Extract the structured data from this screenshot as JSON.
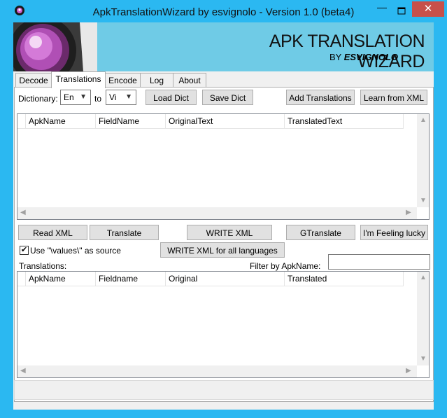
{
  "window": {
    "title": "ApkTranslationWizard by esvignolo - Version 1.0 (beta4)",
    "close_glyph": "✕",
    "minimize_glyph": "—"
  },
  "banner": {
    "title": "APK TRANSLATION WIZARD",
    "sub_prefix": "BY ",
    "sub_author": "ESVIGNOLO"
  },
  "tabs": [
    {
      "label": "Decode"
    },
    {
      "label": "Translations"
    },
    {
      "label": "Encode"
    },
    {
      "label": "Log"
    },
    {
      "label": "About"
    }
  ],
  "dictionary": {
    "label": "Dictionary:",
    "from_value": "En",
    "to_label": "to",
    "to_value": "Vi",
    "load_label": "Load Dict",
    "save_label": "Save Dict",
    "add_translations_label": "Add Translations",
    "learn_xml_label": "Learn from XML"
  },
  "top_grid": {
    "columns": [
      "ApkName",
      "FieldName",
      "OriginalText",
      "TranslatedText"
    ]
  },
  "actions": {
    "read_xml": "Read XML",
    "translate": "Translate",
    "write_xml": "WRITE XML",
    "gtranslate": "GTranslate",
    "lucky": "I'm Feeling lucky",
    "use_values_label": "Use \"\\values\\\" as source",
    "use_values_checked": true,
    "write_all": "WRITE XML for all languages"
  },
  "translations": {
    "label": "Translations:",
    "filter_label": "Filter by ApkName:",
    "filter_value": "",
    "columns": [
      "ApkName",
      "Fieldname",
      "Original",
      "Translated"
    ]
  },
  "colors": {
    "titlebar": "#2bb8f1",
    "banner": "#6fcbe6",
    "close": "#c7504a"
  }
}
